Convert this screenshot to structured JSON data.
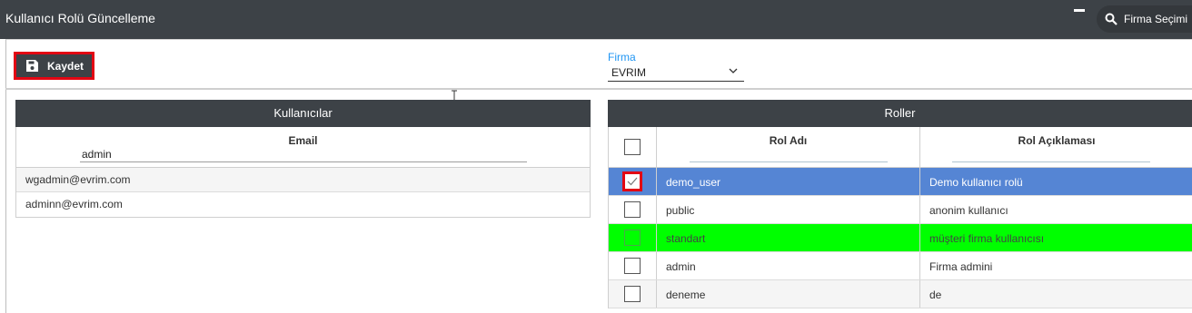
{
  "window": {
    "title": "Kullanıcı Rolü Güncelleme",
    "firma_button_label": "Firma Seçimi"
  },
  "toolbar": {
    "save_label": "Kaydet",
    "firma_label": "Firma",
    "firma_value": "EVRIM"
  },
  "users": {
    "title": "Kullanıcılar",
    "column_header": "Email",
    "filter_value": "admin",
    "rows": [
      "wgadmin@evrim.com",
      "adminn@evrim.com"
    ]
  },
  "roles": {
    "title": "Roller",
    "headers": {
      "name": "Rol Adı",
      "description": "Rol Açıklaması"
    },
    "rows": [
      {
        "name": "demo_user",
        "description": "Demo kullanıcı rolü",
        "checked": true,
        "state": "selected"
      },
      {
        "name": "public",
        "description": "anonim kullanıcı",
        "checked": false,
        "state": "normal"
      },
      {
        "name": "standart",
        "description": "müşteri firma kullanıcısı",
        "checked": false,
        "state": "green"
      },
      {
        "name": "admin",
        "description": "Firma admini",
        "checked": false,
        "state": "normal"
      },
      {
        "name": "deneme",
        "description": "de",
        "checked": false,
        "state": "alt"
      }
    ]
  },
  "colors": {
    "header_bg": "#3d4247",
    "selected_row": "#5585d4",
    "highlight_row": "#00ff00",
    "focus_outline": "#e30613",
    "accent": "#2196f3"
  },
  "icons": [
    "search-icon",
    "save-icon",
    "chevron-down-icon",
    "minimize-icon",
    "text-cursor-icon",
    "checkmark-icon"
  ]
}
